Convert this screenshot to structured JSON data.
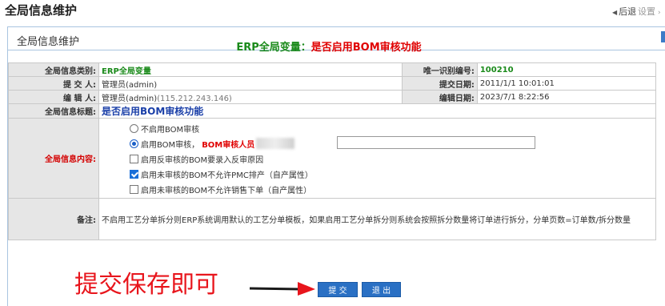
{
  "topbar": {
    "title": "全局信息维护",
    "back_label": "后退",
    "settings_label": "设置"
  },
  "panel": {
    "title": "全局信息维护"
  },
  "heading": {
    "prefix": "ERP全局变量：",
    "value": "是否启用BOM审核功能"
  },
  "form": {
    "category_label": "全局信息类别:",
    "category_value": "ERP全局变量",
    "unique_id_label": "唯一识别编号:",
    "unique_id_value": "100210",
    "submitter_label": "提 交 人:",
    "submitter_value": "管理员(admin)",
    "submit_date_label": "提交日期:",
    "submit_date_value": "2011/1/1 10:01:01",
    "editor_label": "编 辑 人:",
    "editor_value": "管理员(admin)",
    "editor_ip": "(115.212.243.146)",
    "edit_date_label": "编辑日期:",
    "edit_date_value": "2023/7/1 8:22:56",
    "info_title_label": "全局信息标题:",
    "info_title_value": "是否启用BOM审核功能",
    "content_label": "全局信息内容:",
    "options": [
      {
        "type": "radio",
        "checked": false,
        "label": "不启用BOM审核"
      },
      {
        "type": "radio",
        "checked": true,
        "label": "启用BOM审核，",
        "extra_label": "BOM审核人员"
      },
      {
        "type": "checkbox",
        "checked": false,
        "label": "启用反审核的BOM要录入反审原因"
      },
      {
        "type": "checkbox",
        "checked": true,
        "label": "启用未审核的BOM不允许PMC排产（自产属性）"
      },
      {
        "type": "checkbox",
        "checked": false,
        "label": "启用未审核的BOM不允许销售下单（自产属性）"
      }
    ],
    "note_label": "备注:",
    "note_value": "不启用工艺分单拆分则ERP系统调用默认的工艺分单模板，如果启用工艺分单拆分则系统会按照拆分数量将订单进行拆分，分单页数=订单数/拆分数量"
  },
  "annotation": {
    "text": "提交保存即可",
    "color": "#e8151c"
  },
  "buttons": {
    "submit_label": "提 交",
    "exit_label": "退 出"
  },
  "colors": {
    "accent_blue": "#2a70c4",
    "heading_green": "#1a8a1a",
    "heading_red": "#e00000",
    "label_bg": "#e6e6e6"
  }
}
